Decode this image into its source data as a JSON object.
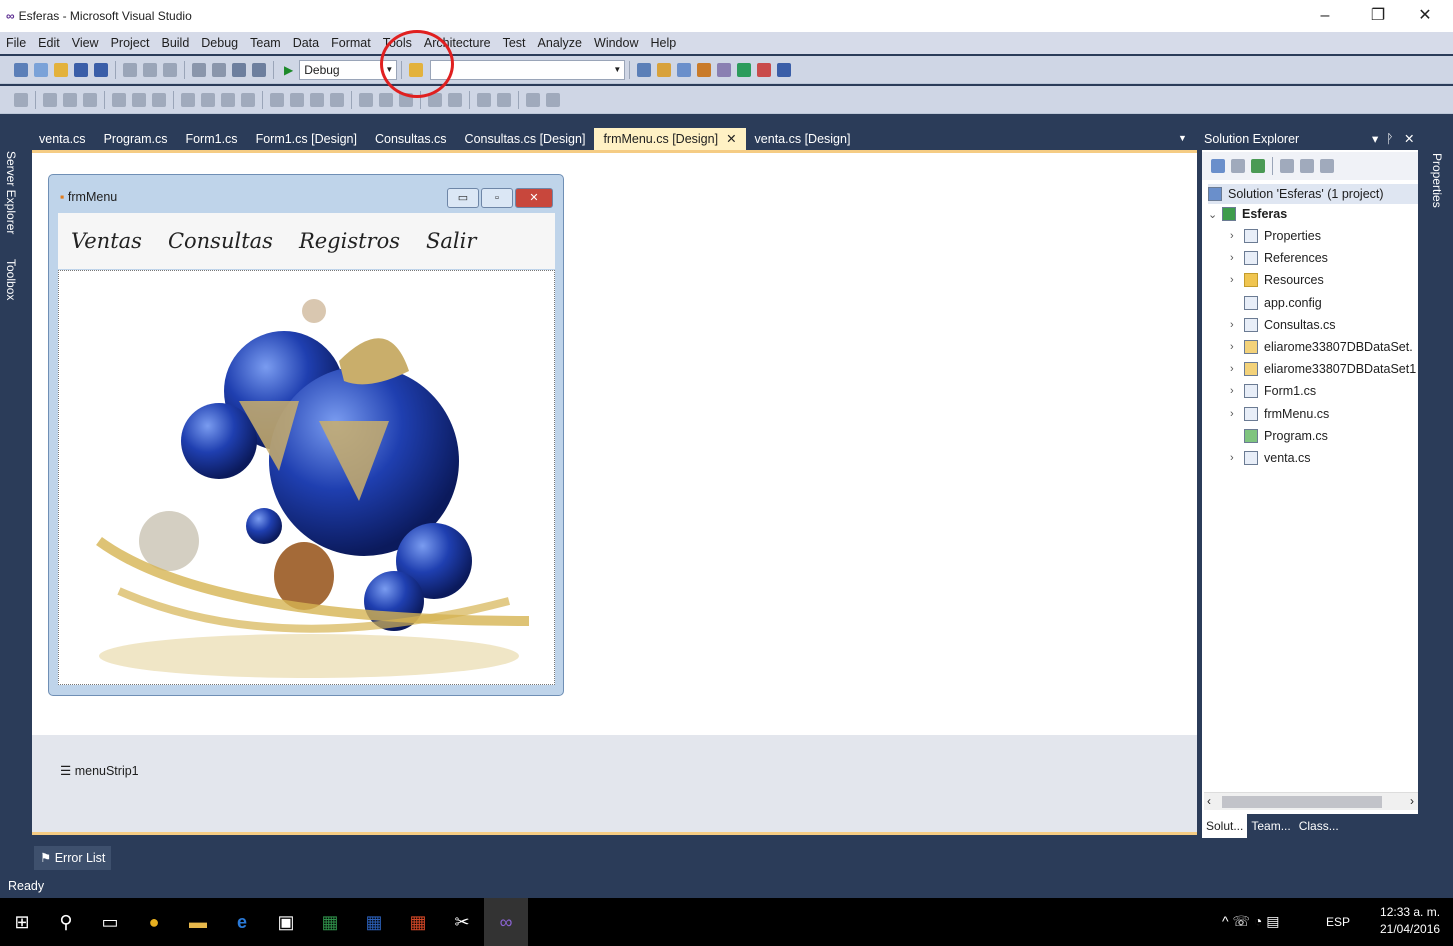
{
  "window": {
    "title": "Esferas - Microsoft Visual Studio"
  },
  "menu": [
    "File",
    "Edit",
    "View",
    "Project",
    "Build",
    "Debug",
    "Team",
    "Data",
    "Format",
    "Tools",
    "Architecture",
    "Test",
    "Analyze",
    "Window",
    "Help"
  ],
  "toolbar": {
    "config_value": "Debug",
    "platform_value": ""
  },
  "tabs": [
    "venta.cs",
    "Program.cs",
    "Form1.cs",
    "Form1.cs [Design]",
    "Consultas.cs",
    "Consultas.cs [Design]",
    "frmMenu.cs [Design]",
    "venta.cs [Design]"
  ],
  "side_left": {
    "server_explorer": "Server Explorer",
    "toolbox": "Toolbox"
  },
  "side_right": {
    "properties": "Properties"
  },
  "designer": {
    "form_title": "frmMenu",
    "menu_items": [
      "Ventas",
      "Consultas",
      "Registros",
      "Salir"
    ],
    "tray_component": "menuStrip1"
  },
  "solution_explorer": {
    "title": "Solution Explorer",
    "solution": "Solution 'Esferas' (1 project)",
    "project": "Esferas",
    "items": [
      "Properties",
      "References",
      "Resources",
      "app.config",
      "Consultas.cs",
      "eliarome33807DBDataSet.",
      "eliarome33807DBDataSet1",
      "Form1.cs",
      "frmMenu.cs",
      "Program.cs",
      "venta.cs"
    ],
    "bottom_tabs": [
      "Solut...",
      "Team...",
      "Class..."
    ]
  },
  "error_list": "Error List",
  "status": "Ready",
  "system_tray": {
    "lang": "ESP",
    "time": "12:33 a. m.",
    "date": "21/04/2016"
  }
}
